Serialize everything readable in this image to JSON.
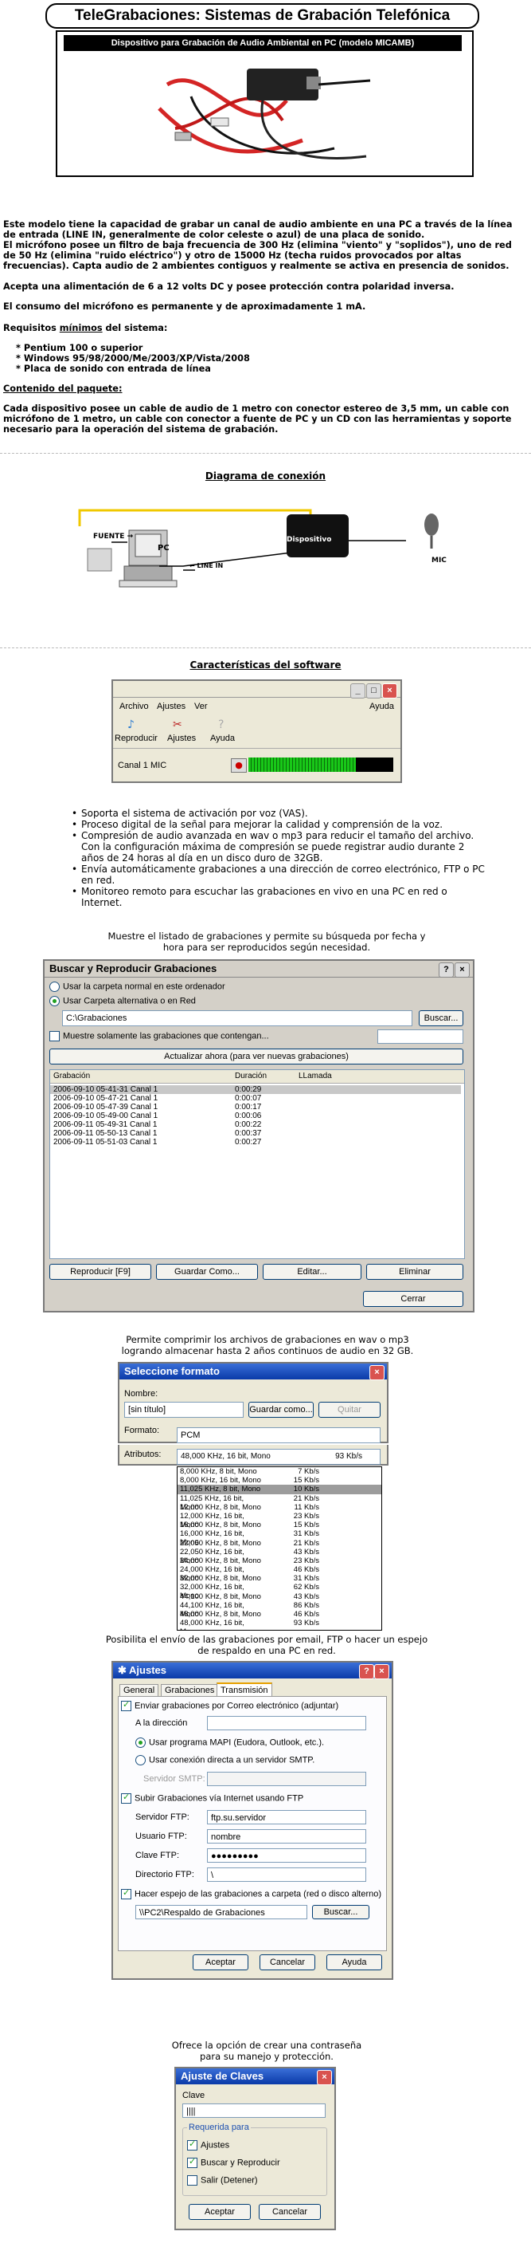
{
  "title": "TeleGrabaciones: Sistemas de Grabación Telefónica",
  "product_caption": "Dispositivo para Grabación de Audio Ambiental en PC (modelo MICAMB)",
  "intro": {
    "p1": "Este modelo tiene la capacidad de grabar un canal de audio ambiente en una PC a través de la línea de entrada (LINE IN, generalmente de color celeste o azul) de una placa de sonido.",
    "p2": "El micrófono posee un filtro de baja frecuencia de 300 Hz (elimina \"viento\" y \"soplidos\"), uno de red de 50 Hz (elimina \"ruido eléctrico\") y otro de 15000 Hz (techa ruidos provocados por altas frecuencias). Capta audio de 2 ambientes contiguos y realmente se activa en presencia de sonidos.",
    "p3": "Acepta una alimentación de 6 a 12 volts DC y posee protección contra polaridad inversa.",
    "p4": "El consumo del micrófono es permanente y de aproximadamente 1 mA.",
    "req_prefix": "Requisitos ",
    "req_u": "mínimos",
    "req_suffix": " del sistema:",
    "req_items": [
      "Pentium 100 o superior",
      "Windows 95/98/2000/Me/2003/XP/Vista/2008",
      "Placa de sonido con entrada de línea"
    ],
    "pkg_title": "Contenido del paquete:",
    "pkg_text": "Cada dispositivo posee un cable de audio de 1 metro con conector estereo de 3,5 mm, un cable con micrófono de 1 metro, un cable con conector a fuente de PC y un CD con las herramientas y soporte necesario para la operación del sistema de grabación."
  },
  "diagram": {
    "heading": "Diagrama de conexión",
    "fuente": "FUENTE",
    "pc": "PC",
    "line_in": "LINE IN",
    "dispositivo": "Dispositivo",
    "mic": "MIC"
  },
  "software": {
    "heading": "Características del software",
    "menu": [
      "Archivo",
      "Ajustes",
      "Ver"
    ],
    "help": "Ayuda",
    "tool_reproducir": "Reproducir",
    "tool_ajustes": "Ajustes",
    "tool_ayuda": "Ayuda",
    "channel": "Canal 1 MIC",
    "level_fraction": 0.74,
    "features": [
      "Soporta el sistema de activación por voz (VAS).",
      "Proceso digital de la señal para mejorar la calidad y comprensión de la voz.",
      "Compresión de audio avanzada en wav o mp3 para reducir el tamaño del archivo. Con la configuración máxima de compresión se puede registrar audio durante 2 años de 24 horas al día en un disco duro de 32GB.",
      "Envía automáticamente grabaciones a una dirección de correo electrónico, FTP o PC en red.",
      "Monitoreo remoto para escuchar las grabaciones en vivo en una PC en red o Internet."
    ]
  },
  "search": {
    "caption": "Muestre el listado de grabaciones y permite su búsqueda por fecha y hora para ser reproducidos según necesidad.",
    "title": "Buscar y Reproducir Grabaciones",
    "opt1": "Usar la carpeta normal en este ordenador",
    "opt2": "Usar Carpeta alternativa o en Red",
    "path": "C:\\Grabaciones",
    "buscar": "Buscar...",
    "filter": "Muestre solamente las grabaciones que contengan...",
    "update": "Actualizar ahora (para ver nuevas grabaciones)",
    "col_grab": "Grabación",
    "col_dur": "Duración",
    "col_call": "LLamada",
    "rows": [
      [
        "2006-09-10 05-41-31 Canal 1",
        "0:00:29"
      ],
      [
        "2006-09-10 05-47-21 Canal 1",
        "0:00:07"
      ],
      [
        "2006-09-10 05-47-39 Canal 1",
        "0:00:17"
      ],
      [
        "2006-09-10 05-49-00 Canal 1",
        "0:00:06"
      ],
      [
        "2006-09-11 05-49-31 Canal 1",
        "0:00:22"
      ],
      [
        "2006-09-11 05-50-13 Canal 1",
        "0:00:37"
      ],
      [
        "2006-09-11 05-51-03 Canal 1",
        "0:00:27"
      ]
    ],
    "btn_play": "Reproducir [F9]",
    "btn_save": "Guardar Como...",
    "btn_edit": "Editar...",
    "btn_delete": "Eliminar",
    "btn_close": "Cerrar"
  },
  "format": {
    "caption": "Permite comprimir los archivos de grabaciones en wav o mp3 logrando almacenar hasta 2 años continuos de audio en 32 GB.",
    "title": "Seleccione formato",
    "name_label": "Nombre:",
    "name_value": "[sin título]",
    "save_as": "Guardar como...",
    "remove": "Quitar",
    "format_label": "Formato:",
    "format_value": "PCM",
    "attr_label": "Atributos:",
    "attr_value": "48,000 KHz, 16 bit, Mono",
    "attr_rate": "93 Kb/s",
    "options": [
      [
        "8,000 KHz, 8 bit, Mono",
        "7 Kb/s"
      ],
      [
        "8,000 KHz, 16 bit, Mono",
        "15 Kb/s"
      ],
      [
        "11,025 KHz, 8 bit, Mono",
        "10 Kb/s"
      ],
      [
        "11,025 KHz, 16 bit, Mono",
        "21 Kb/s"
      ],
      [
        "12,000 KHz, 8 bit, Mono",
        "11 Kb/s"
      ],
      [
        "12,000 KHz, 16 bit, Mono",
        "23 Kb/s"
      ],
      [
        "16,000 KHz, 8 bit, Mono",
        "15 Kb/s"
      ],
      [
        "16,000 KHz, 16 bit, Mono",
        "31 Kb/s"
      ],
      [
        "22,050 KHz, 8 bit, Mono",
        "21 Kb/s"
      ],
      [
        "22,050 KHz, 16 bit, Mono",
        "43 Kb/s"
      ],
      [
        "24,000 KHz, 8 bit, Mono",
        "23 Kb/s"
      ],
      [
        "24,000 KHz, 16 bit, Mono",
        "46 Kb/s"
      ],
      [
        "32,000 KHz, 8 bit, Mono",
        "31 Kb/s"
      ],
      [
        "32,000 KHz, 16 bit, Mono",
        "62 Kb/s"
      ],
      [
        "44,100 KHz, 8 bit, Mono",
        "43 Kb/s"
      ],
      [
        "44,100 KHz, 16 bit, Mono",
        "86 Kb/s"
      ],
      [
        "48,000 KHz, 8 bit, Mono",
        "46 Kb/s"
      ],
      [
        "48,000 KHz, 16 bit, Mono",
        "93 Kb/s"
      ]
    ]
  },
  "settings": {
    "caption": "Posibilita el envío de las grabaciones por email, FTP o hacer un espejo de respaldo en una PC en red.",
    "title": "Ajustes",
    "tabs": [
      "General",
      "Grabaciones",
      "Transmisión"
    ],
    "email_check": "Enviar grabaciones por Correo electrónico (adjuntar)",
    "email_to": "A la dirección",
    "mapi": "Usar programa MAPI (Eudora, Outlook, etc.).",
    "smtp": "Usar conexión directa a un servidor SMTP.",
    "smtp_server": "Servidor SMTP:",
    "ftp_check": "Subir Grabaciones vía Internet usando FTP",
    "ftp_server_label": "Servidor FTP:",
    "ftp_server": "ftp.su.servidor",
    "ftp_user_label": "Usuario FTP:",
    "ftp_user": "nombre",
    "ftp_pass_label": "Clave FTP:",
    "ftp_pass": "●●●●●●●●●",
    "ftp_dir_label": "Directorio FTP:",
    "ftp_dir": "\\",
    "mirror_check": "Hacer espejo de las grabaciones a carpeta (red o disco alterno)",
    "mirror_path": "\\\\PC2\\Respaldo de Grabaciones",
    "buscar": "Buscar...",
    "ok": "Aceptar",
    "cancel": "Cancelar",
    "help": "Ayuda"
  },
  "password": {
    "caption": "Ofrece la opción de crear una contraseña para su manejo y protección.",
    "title": "Ajuste de Claves",
    "clave_label": "Clave",
    "clave_value": "||||",
    "group": "Requerida para",
    "items": [
      "Ajustes",
      "Buscar y Reproducir",
      "Salir (Detener)"
    ],
    "ok": "Aceptar",
    "cancel": "Cancelar"
  }
}
